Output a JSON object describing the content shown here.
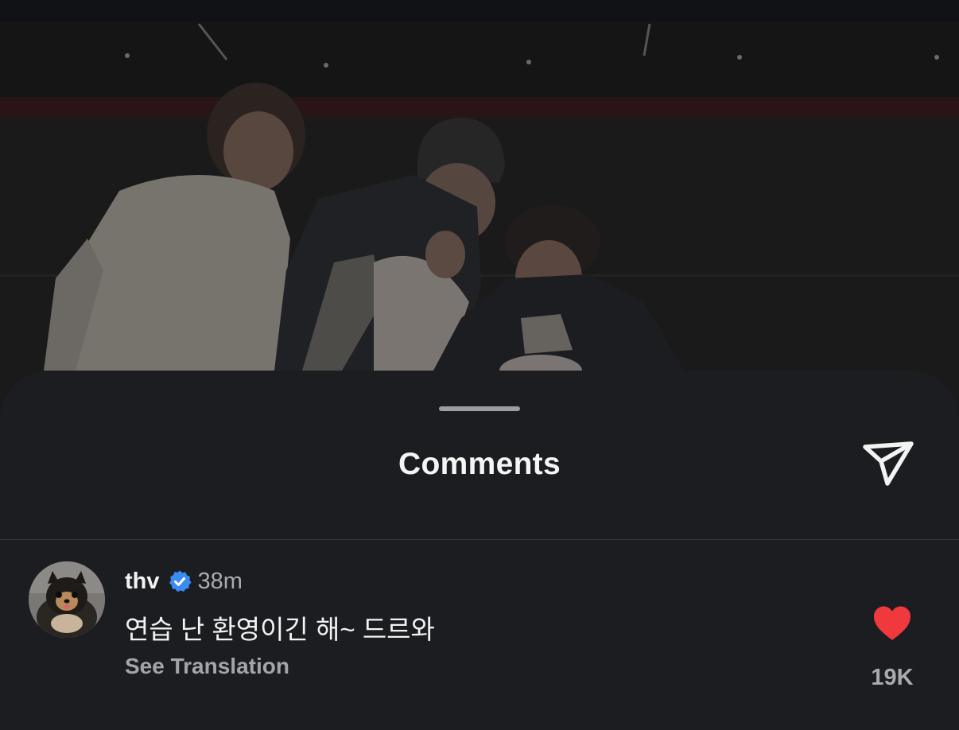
{
  "sheet": {
    "title": "Comments"
  },
  "comment": {
    "username": "thv",
    "verified": true,
    "timestamp": "38m",
    "text": "연습 난 환영이긴 해~ 드르와",
    "see_translation_label": "See Translation",
    "like_count": "19K"
  },
  "colors": {
    "sheet_bg": "#1b1d21",
    "verified_blue": "#3b8cf2",
    "like_red": "#f0393d",
    "text_primary": "#f3f3f3",
    "text_secondary": "#a9abb0"
  },
  "icons": {
    "share": "paper-plane-icon",
    "verified": "verified-badge-icon",
    "like": "heart-icon"
  }
}
